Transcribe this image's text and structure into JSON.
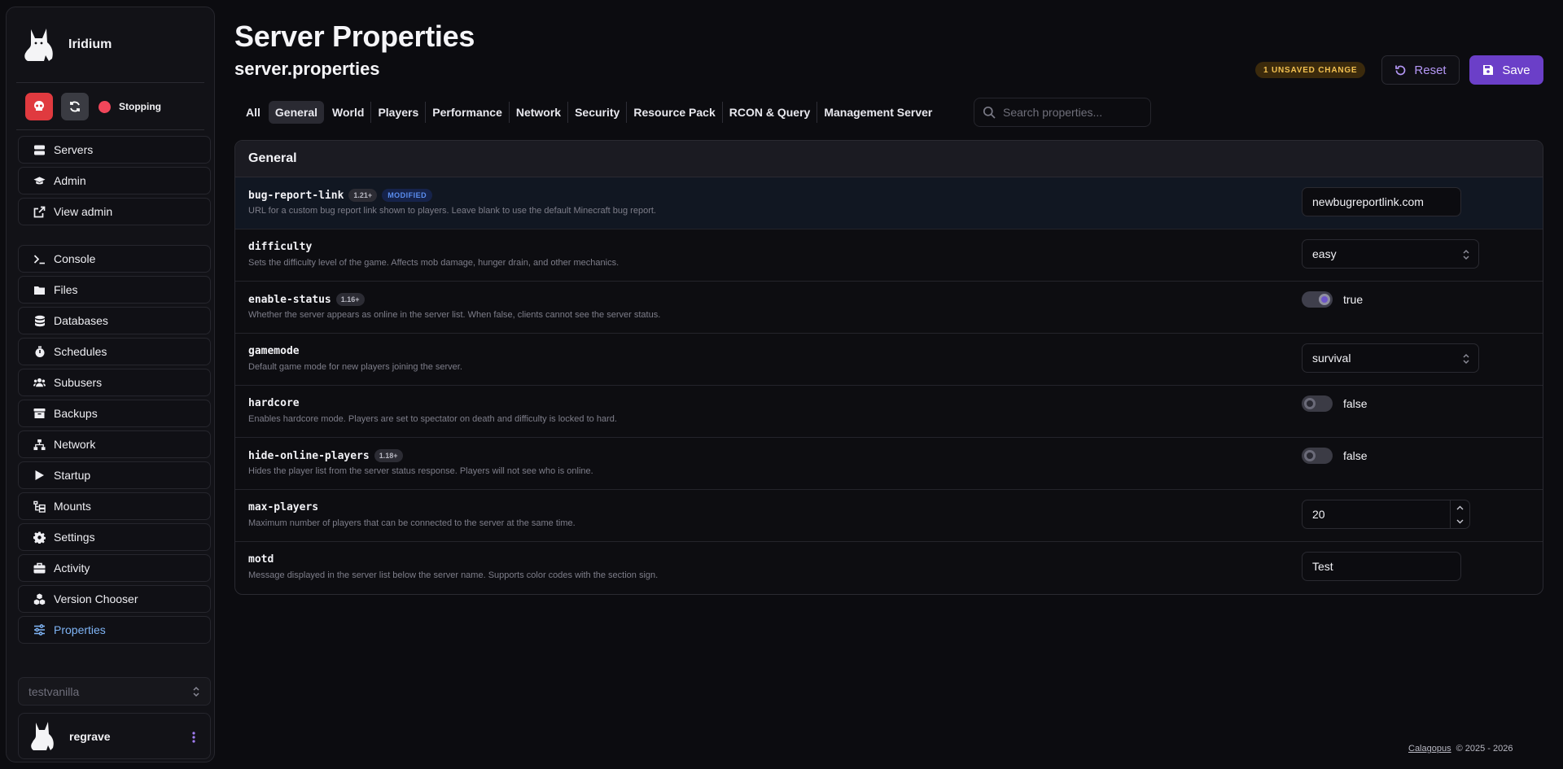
{
  "sidebar": {
    "brand_name": "Iridium",
    "status": "Stopping",
    "nav": [
      {
        "label": "Servers",
        "icon": "server-icon"
      },
      {
        "label": "Admin",
        "icon": "graduation-cap-icon"
      },
      {
        "label": "View admin",
        "icon": "external-link-icon"
      },
      {
        "label": "Console",
        "icon": "terminal-icon"
      },
      {
        "label": "Files",
        "icon": "folder-icon"
      },
      {
        "label": "Databases",
        "icon": "database-icon"
      },
      {
        "label": "Schedules",
        "icon": "stopwatch-icon"
      },
      {
        "label": "Subusers",
        "icon": "users-icon"
      },
      {
        "label": "Backups",
        "icon": "archive-icon"
      },
      {
        "label": "Network",
        "icon": "network-icon"
      },
      {
        "label": "Startup",
        "icon": "play-icon"
      },
      {
        "label": "Mounts",
        "icon": "folder-tree-icon"
      },
      {
        "label": "Settings",
        "icon": "gear-icon"
      },
      {
        "label": "Activity",
        "icon": "briefcase-icon"
      },
      {
        "label": "Version Chooser",
        "icon": "cubes-icon"
      },
      {
        "label": "Properties",
        "icon": "sliders-icon"
      }
    ],
    "server_select": "testvanilla",
    "user_name": "regrave"
  },
  "header": {
    "title": "Server Properties",
    "subtitle": "server.properties",
    "unsaved_badge": "1 UNSAVED CHANGE",
    "reset_label": "Reset",
    "save_label": "Save"
  },
  "tabs": [
    "All",
    "General",
    "World",
    "Players",
    "Performance",
    "Network",
    "Security",
    "Resource Pack",
    "RCON & Query",
    "Management Server"
  ],
  "active_tab": "General",
  "search": {
    "placeholder": "Search properties..."
  },
  "section": {
    "title": "General",
    "properties": [
      {
        "key": "bug-report-link",
        "version": "1.21+",
        "badge": "MODIFIED",
        "description": "URL for a custom bug report link shown to players. Leave blank to use the default Minecraft bug report.",
        "control": "text",
        "value": "newbugreportlink.com"
      },
      {
        "key": "difficulty",
        "description": "Sets the difficulty level of the game. Affects mob damage, hunger drain, and other mechanics.",
        "control": "select",
        "value": "easy"
      },
      {
        "key": "enable-status",
        "version": "1.16+",
        "description": "Whether the server appears as online in the server list. When false, clients cannot see the server status.",
        "control": "toggle",
        "value": "true"
      },
      {
        "key": "gamemode",
        "description": "Default game mode for new players joining the server.",
        "control": "select",
        "value": "survival"
      },
      {
        "key": "hardcore",
        "description": "Enables hardcore mode. Players are set to spectator on death and difficulty is locked to hard.",
        "control": "toggle",
        "value": "false"
      },
      {
        "key": "hide-online-players",
        "version": "1.18+",
        "description": "Hides the player list from the server status response. Players will not see who is online.",
        "control": "toggle",
        "value": "false"
      },
      {
        "key": "max-players",
        "description": "Maximum number of players that can be connected to the server at the same time.",
        "control": "number",
        "value": "20"
      },
      {
        "key": "motd",
        "description": "Message displayed in the server list below the server name. Supports color codes with the section sign.",
        "control": "text",
        "value": "Test"
      }
    ]
  },
  "footer": {
    "link": "Calagopus",
    "text": "© 2025 - 2026"
  },
  "colors": {
    "accent": "#6b3fc8",
    "active_nav": "#7fb4f5",
    "kill": "#e03a3f",
    "status": "#f0465a",
    "warning": "#f2c050"
  }
}
